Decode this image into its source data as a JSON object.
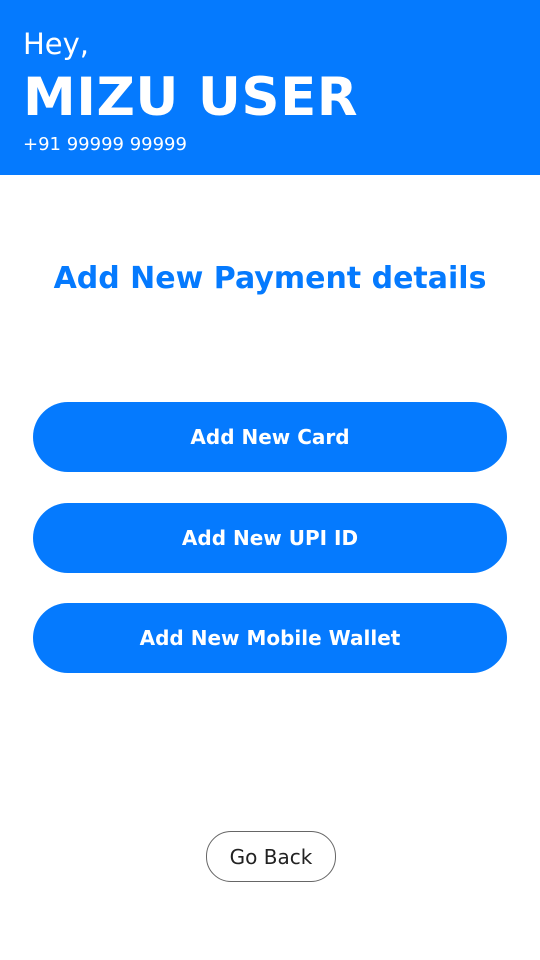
{
  "colors": {
    "accent": "#057AFE",
    "button_text": "#FFFFFF",
    "outline": "#666666"
  },
  "header": {
    "greeting": "Hey,",
    "name": "MIZU USER",
    "phone": "+91 99999 99999"
  },
  "main": {
    "title": "Add New Payment details",
    "buttons": [
      {
        "label": "Add New Card"
      },
      {
        "label": "Add New UPI ID"
      },
      {
        "label": "Add New Mobile Wallet"
      }
    ]
  },
  "footer": {
    "go_back_label": "Go Back"
  }
}
